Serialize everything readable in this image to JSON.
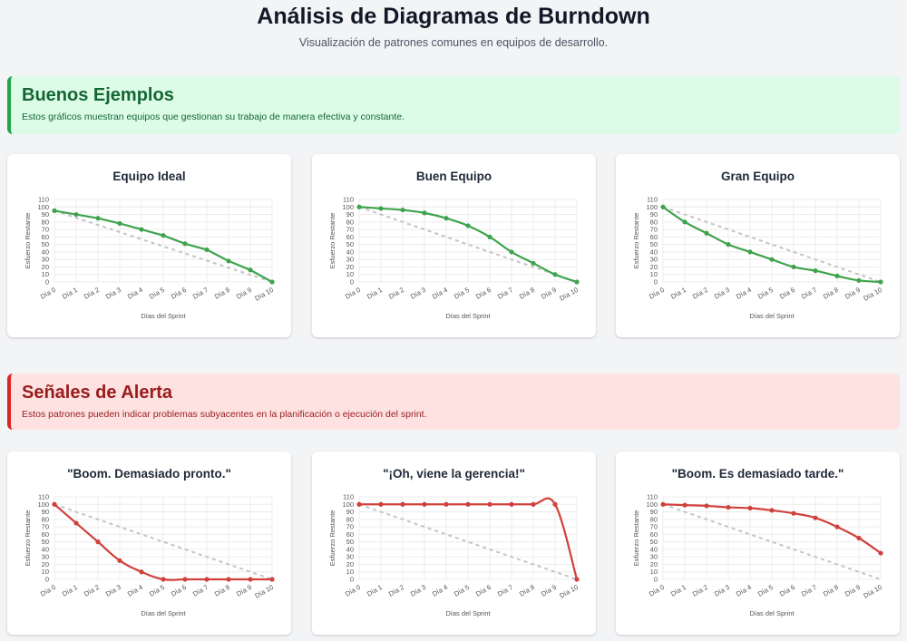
{
  "header": {
    "title": "Análisis de Diagramas de Burndown",
    "subtitle": "Visualización de patrones comunes en equipos de desarrollo."
  },
  "good_section": {
    "title": "Buenos Ejemplos",
    "description": "Estos gráficos muestran equipos que gestionan su trabajo de manera efectiva y constante."
  },
  "bad_section": {
    "title": "Señales de Alerta",
    "description": "Estos patrones pueden indicar problemas subyacentes en la planificación o ejecución del sprint."
  },
  "colors": {
    "good": "#3fa34d",
    "bad": "#d0413d",
    "ideal": "#c4c4c4"
  },
  "chart_data": [
    {
      "type": "line",
      "title": "Equipo Ideal",
      "xlabel": "Días del Sprint",
      "ylabel": "Esfuerzo Restante",
      "categories": [
        "Día 0",
        "Día 1",
        "Día 2",
        "Día 3",
        "Día 4",
        "Día 5",
        "Día 6",
        "Día 7",
        "Día 8",
        "Día 9",
        "Día 10"
      ],
      "ylim": [
        0,
        110
      ],
      "yticks": [
        0,
        10,
        20,
        30,
        40,
        50,
        60,
        70,
        80,
        90,
        100,
        110
      ],
      "series": [
        {
          "values": [
            95,
            90,
            85,
            78,
            70,
            62,
            51,
            43,
            28,
            16,
            0
          ],
          "color": "#3fa34d",
          "smooth": false
        },
        {
          "values": [
            95,
            85.5,
            76,
            66.5,
            57,
            47.5,
            38,
            28.5,
            19,
            9.5,
            0
          ],
          "color": "#c4c4c4",
          "dashed": true
        }
      ]
    },
    {
      "type": "line",
      "title": "Buen Equipo",
      "xlabel": "Días del Sprint",
      "ylabel": "Esfuerzo Restante",
      "categories": [
        "Día 0",
        "Día 1",
        "Día 2",
        "Día 3",
        "Día 4",
        "Día 5",
        "Día 6",
        "Día 7",
        "Día 8",
        "Día 9",
        "Día 10"
      ],
      "ylim": [
        0,
        110
      ],
      "yticks": [
        0,
        10,
        20,
        30,
        40,
        50,
        60,
        70,
        80,
        90,
        100,
        110
      ],
      "series": [
        {
          "values": [
            100,
            98,
            96,
            92,
            85,
            75,
            60,
            40,
            25,
            10,
            0
          ],
          "color": "#3fa34d",
          "smooth": true
        },
        {
          "values": [
            100,
            90,
            80,
            70,
            60,
            50,
            40,
            30,
            20,
            10,
            0
          ],
          "color": "#c4c4c4",
          "dashed": true
        }
      ]
    },
    {
      "type": "line",
      "title": "Gran Equipo",
      "xlabel": "Días del Sprint",
      "ylabel": "Esfuerzo Restante",
      "categories": [
        "Día 0",
        "Día 1",
        "Día 2",
        "Día 3",
        "Día 4",
        "Día 5",
        "Día 6",
        "Día 7",
        "Día 8",
        "Día 9",
        "Día 10"
      ],
      "ylim": [
        0,
        110
      ],
      "yticks": [
        0,
        10,
        20,
        30,
        40,
        50,
        60,
        70,
        80,
        90,
        100,
        110
      ],
      "series": [
        {
          "values": [
            100,
            80,
            65,
            50,
            40,
            30,
            20,
            15,
            8,
            2,
            0
          ],
          "color": "#3fa34d",
          "smooth": true
        },
        {
          "values": [
            100,
            90,
            80,
            70,
            60,
            50,
            40,
            30,
            20,
            10,
            0
          ],
          "color": "#c4c4c4",
          "dashed": true
        }
      ]
    },
    {
      "type": "line",
      "title": "\"Boom. Demasiado pronto.\"",
      "xlabel": "Días del Sprint",
      "ylabel": "Esfuerzo Restante",
      "categories": [
        "Día 0",
        "Día 1",
        "Día 2",
        "Día 3",
        "Día 4",
        "Día 5",
        "Día 6",
        "Día 7",
        "Día 8",
        "Día 9",
        "Día 10"
      ],
      "ylim": [
        0,
        110
      ],
      "yticks": [
        0,
        10,
        20,
        30,
        40,
        50,
        60,
        70,
        80,
        90,
        100,
        110
      ],
      "series": [
        {
          "values": [
            100,
            75,
            50,
            25,
            10,
            0,
            0,
            0,
            0,
            0,
            0
          ],
          "color": "#d0413d",
          "smooth": true
        },
        {
          "values": [
            100,
            90,
            80,
            70,
            60,
            50,
            40,
            30,
            20,
            10,
            0
          ],
          "color": "#c4c4c4",
          "dashed": true
        }
      ]
    },
    {
      "type": "line",
      "title": "\"¡Oh, viene la gerencia!\"",
      "xlabel": "Días del Sprint",
      "ylabel": "Esfuerzo Restante",
      "categories": [
        "Día 0",
        "Día 1",
        "Día 2",
        "Día 3",
        "Día 4",
        "Día 5",
        "Día 6",
        "Día 7",
        "Día 8",
        "Día 9",
        "Día 10"
      ],
      "ylim": [
        0,
        110
      ],
      "yticks": [
        0,
        10,
        20,
        30,
        40,
        50,
        60,
        70,
        80,
        90,
        100,
        110
      ],
      "series": [
        {
          "values": [
            100,
            100,
            100,
            100,
            100,
            100,
            100,
            100,
            100,
            100,
            0
          ],
          "color": "#d0413d",
          "smooth": true
        },
        {
          "values": [
            100,
            90,
            80,
            70,
            60,
            50,
            40,
            30,
            20,
            10,
            0
          ],
          "color": "#c4c4c4",
          "dashed": true
        }
      ]
    },
    {
      "type": "line",
      "title": "\"Boom. Es demasiado tarde.\"",
      "xlabel": "Días del Sprint",
      "ylabel": "Esfuerzo Restante",
      "categories": [
        "Día 0",
        "Día 1",
        "Día 2",
        "Día 3",
        "Día 4",
        "Día 5",
        "Día 6",
        "Día 7",
        "Día 8",
        "Día 9",
        "Día 10"
      ],
      "ylim": [
        0,
        110
      ],
      "yticks": [
        0,
        10,
        20,
        30,
        40,
        50,
        60,
        70,
        80,
        90,
        100,
        110
      ],
      "series": [
        {
          "values": [
            100,
            99,
            98,
            96,
            95,
            92,
            88,
            82,
            70,
            55,
            35
          ],
          "color": "#d0413d",
          "smooth": true
        },
        {
          "values": [
            100,
            90,
            80,
            70,
            60,
            50,
            40,
            30,
            20,
            10,
            0
          ],
          "color": "#c4c4c4",
          "dashed": true
        }
      ]
    }
  ]
}
